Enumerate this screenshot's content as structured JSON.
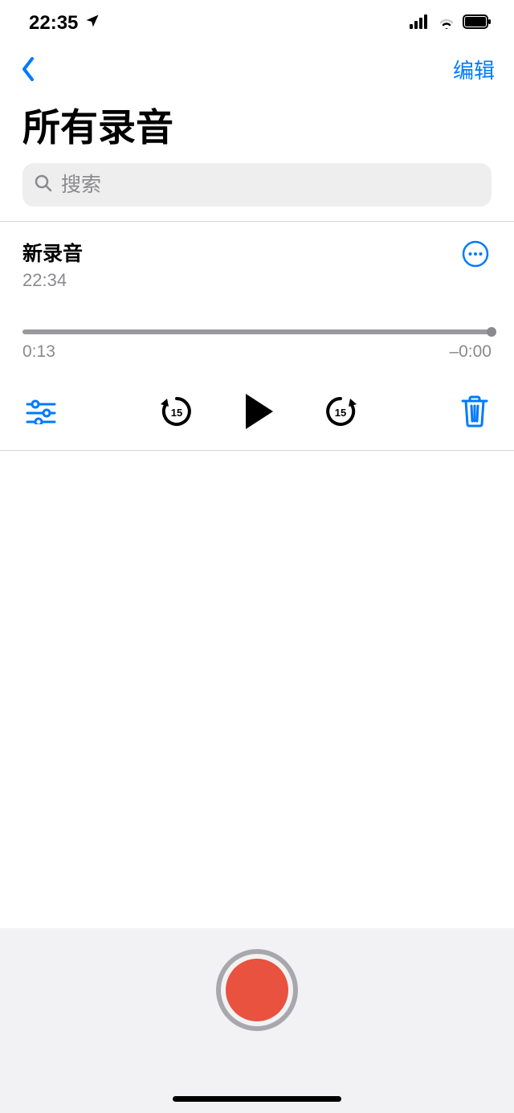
{
  "status": {
    "time": "22:35"
  },
  "nav": {
    "edit_label": "编辑"
  },
  "title": "所有录音",
  "search": {
    "placeholder": "搜索"
  },
  "recording": {
    "name": "新录音",
    "subtitle": "22:34",
    "elapsed": "0:13",
    "remaining": "–0:00"
  }
}
